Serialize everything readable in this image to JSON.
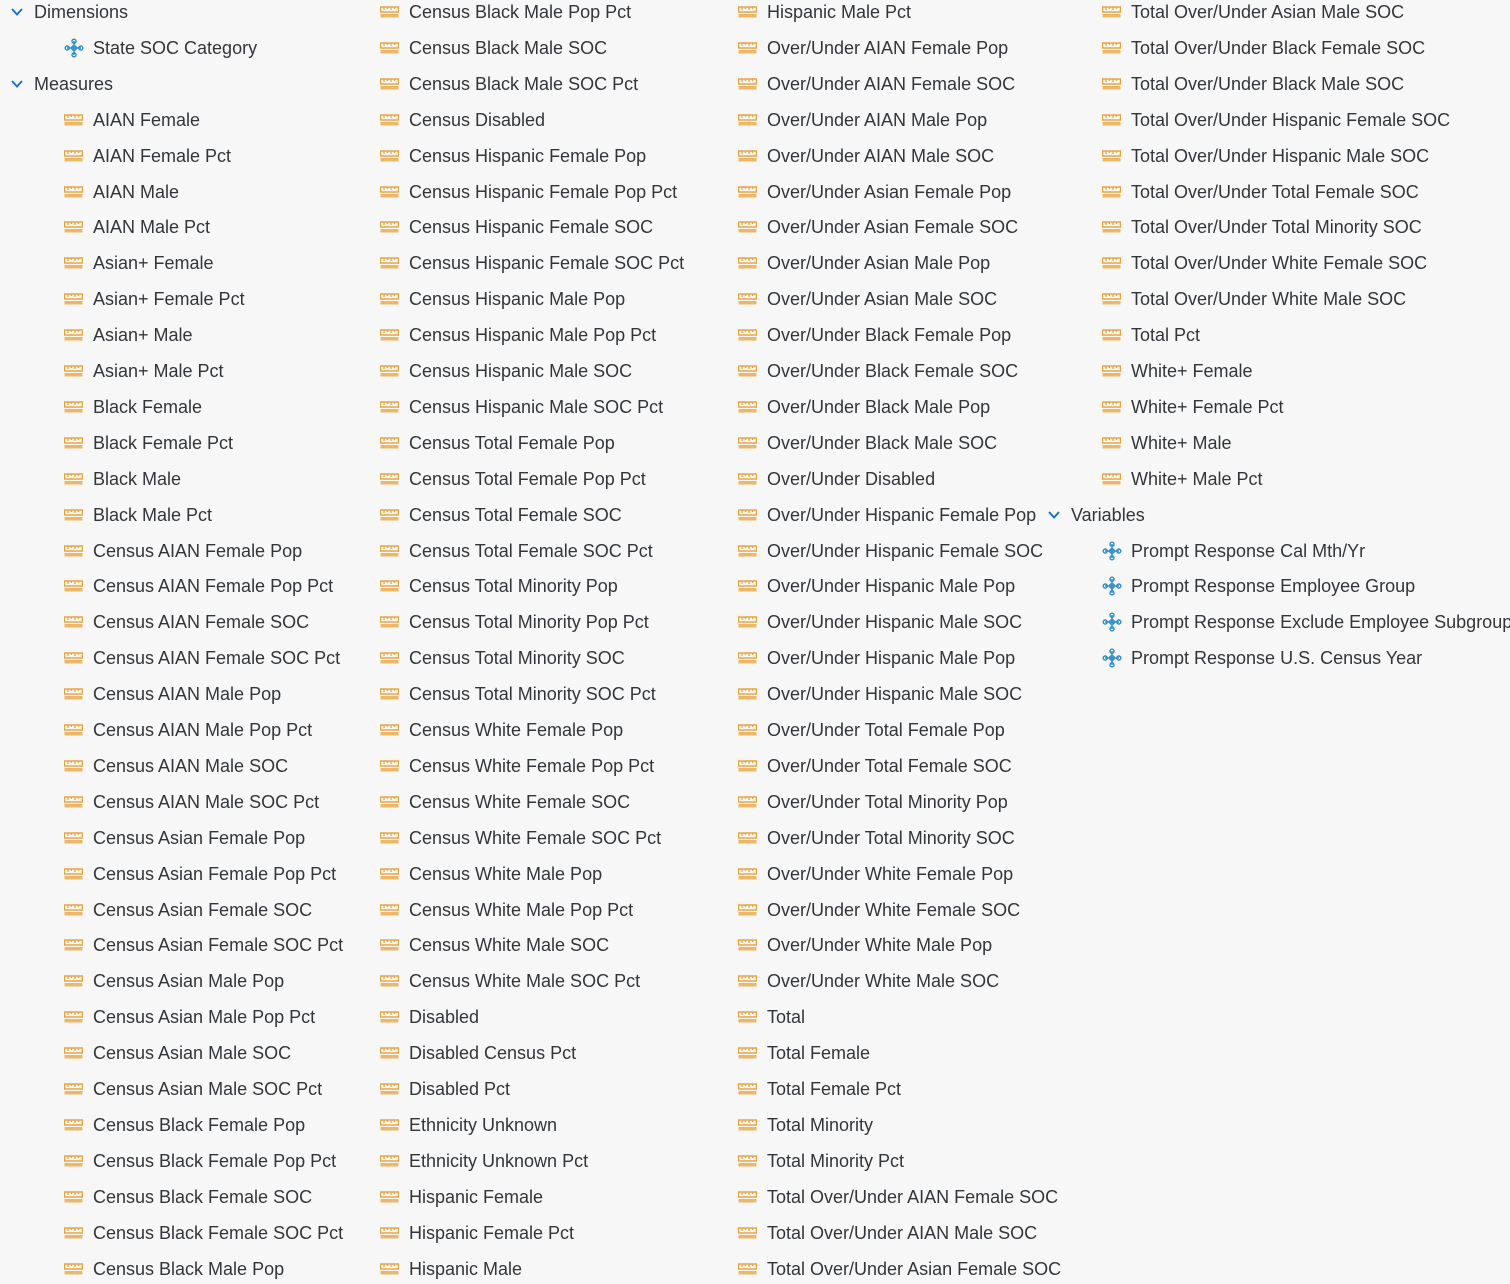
{
  "colors": {
    "measure_icon": "#e8a13a",
    "dimension_icon": "#2b8ccc",
    "chevron": "#0a6ed1",
    "text": "#32363a",
    "background": "#f7f7f7"
  },
  "icons": {
    "measure": "measure-ruler-icon",
    "dimension": "dimension-hierarchy-icon",
    "expand": "chevron-down-icon"
  },
  "tree": {
    "dimensions_label": "Dimensions",
    "dimensions": [
      "State SOC Category"
    ],
    "measures_label": "Measures",
    "measures": [
      "AIAN Female",
      "AIAN Female Pct",
      "AIAN Male",
      "AIAN Male Pct",
      "Asian+ Female",
      "Asian+ Female Pct",
      "Asian+ Male",
      "Asian+ Male Pct",
      "Black Female",
      "Black Female Pct",
      "Black Male",
      "Black Male Pct",
      "Census AIAN Female Pop",
      "Census AIAN Female Pop Pct",
      "Census AIAN Female SOC",
      "Census AIAN Female SOC Pct",
      "Census AIAN Male Pop",
      "Census AIAN Male Pop Pct",
      "Census AIAN Male SOC",
      "Census AIAN Male SOC Pct",
      "Census Asian Female Pop",
      "Census Asian Female Pop Pct",
      "Census Asian Female SOC",
      "Census Asian Female SOC Pct",
      "Census Asian Male Pop",
      "Census Asian Male Pop Pct",
      "Census Asian Male SOC",
      "Census Asian Male SOC Pct",
      "Census Black Female Pop",
      "Census Black Female Pop Pct",
      "Census Black Female SOC",
      "Census Black Female SOC Pct",
      "Census Black Male Pop",
      "Census Black Male Pop Pct",
      "Census Black Male SOC",
      "Census Black Male SOC Pct",
      "Census Disabled",
      "Census Hispanic Female Pop",
      "Census Hispanic Female Pop Pct",
      "Census Hispanic Female SOC",
      "Census Hispanic Female SOC Pct",
      "Census Hispanic Male Pop",
      "Census Hispanic Male Pop Pct",
      "Census Hispanic Male SOC",
      "Census Hispanic Male SOC Pct",
      "Census Total Female Pop",
      "Census Total Female Pop Pct",
      "Census Total Female SOC",
      "Census Total Female SOC Pct",
      "Census Total Minority Pop",
      "Census Total Minority Pop Pct",
      "Census Total Minority SOC",
      "Census Total Minority SOC Pct",
      "Census White Female Pop",
      "Census White Female Pop Pct",
      "Census White Female SOC",
      "Census White Female SOC Pct",
      "Census White Male Pop",
      "Census White Male Pop Pct",
      "Census White Male SOC",
      "Census White Male SOC Pct",
      "Disabled",
      "Disabled Census Pct",
      "Disabled Pct",
      "Ethnicity Unknown",
      "Ethnicity Unknown Pct",
      "Hispanic Female",
      "Hispanic Female Pct",
      "Hispanic Male",
      "Hispanic Male Pct",
      "Over/Under AIAN Female Pop",
      "Over/Under AIAN Female SOC",
      "Over/Under AIAN Male Pop",
      "Over/Under AIAN Male SOC",
      "Over/Under Asian Female Pop",
      "Over/Under Asian Female SOC",
      "Over/Under Asian Male Pop",
      "Over/Under Asian Male SOC",
      "Over/Under Black Female Pop",
      "Over/Under Black Female SOC",
      "Over/Under Black Male Pop",
      "Over/Under Black Male SOC",
      "Over/Under Disabled",
      "Over/Under Hispanic Female Pop",
      "Over/Under Hispanic Female SOC",
      "Over/Under Hispanic Male Pop",
      "Over/Under Hispanic Male SOC",
      "Over/Under Hispanic Male Pop",
      "Over/Under Hispanic Male SOC",
      "Over/Under Total Female Pop",
      "Over/Under Total Female SOC",
      "Over/Under Total Minority Pop",
      "Over/Under Total Minority SOC",
      "Over/Under White Female Pop",
      "Over/Under White Female SOC",
      "Over/Under White Male Pop",
      "Over/Under White Male SOC",
      "Total",
      "Total Female",
      "Total Female Pct",
      "Total Minority",
      "Total Minority Pct",
      "Total Over/Under AIAN Female SOC",
      "Total Over/Under AIAN Male SOC",
      "Total Over/Under Asian Female SOC",
      "Total Over/Under Asian Male SOC",
      "Total Over/Under Black Female SOC",
      "Total Over/Under Black Male SOC",
      "Total Over/Under Hispanic Female SOC",
      "Total Over/Under Hispanic Male SOC",
      "Total Over/Under Total Female SOC",
      "Total Over/Under Total Minority SOC",
      "Total Over/Under White Female SOC",
      "Total Over/Under White Male SOC",
      "Total Pct",
      "White+ Female",
      "White+ Female Pct",
      "White+ Male",
      "White+ Male Pct"
    ],
    "variables_label": "Variables",
    "variables": [
      "Prompt Response Cal Mth/Yr",
      "Prompt Response Employee Group",
      "Prompt Response Exclude Employee Subgroup",
      "Prompt Response U.S. Census Year"
    ]
  }
}
